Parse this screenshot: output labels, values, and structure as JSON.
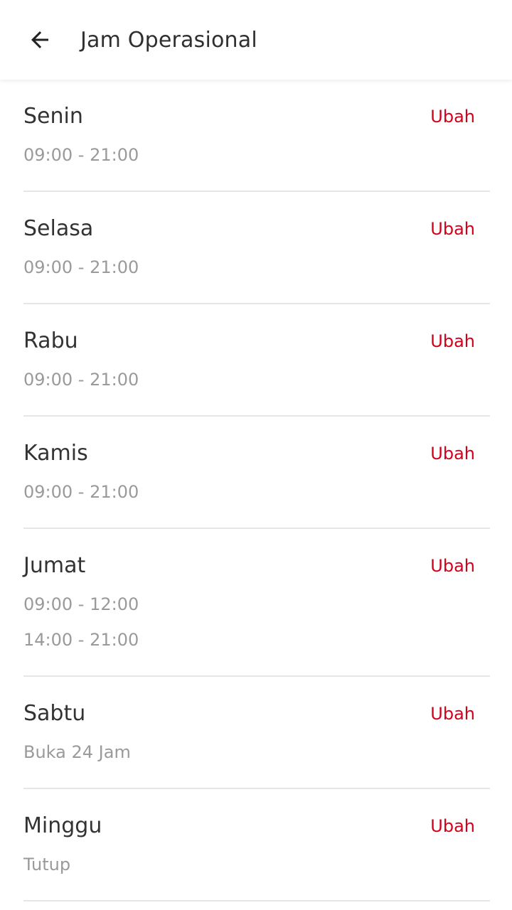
{
  "header": {
    "title": "Jam Operasional",
    "back_icon": "arrow-back-icon"
  },
  "colors": {
    "accent": "#d0021b",
    "day_text": "#333333",
    "hours_text": "#9a9a9a",
    "divider": "#e6e6e6"
  },
  "days": [
    {
      "name": "Senin",
      "edit_label": "Ubah",
      "hours": [
        "09:00 - 21:00"
      ]
    },
    {
      "name": "Selasa",
      "edit_label": "Ubah",
      "hours": [
        "09:00 - 21:00"
      ]
    },
    {
      "name": "Rabu",
      "edit_label": "Ubah",
      "hours": [
        "09:00 - 21:00"
      ]
    },
    {
      "name": "Kamis",
      "edit_label": "Ubah",
      "hours": [
        "09:00 - 21:00"
      ]
    },
    {
      "name": "Jumat",
      "edit_label": "Ubah",
      "hours": [
        "09:00 - 12:00",
        "14:00 - 21:00"
      ]
    },
    {
      "name": "Sabtu",
      "edit_label": "Ubah",
      "hours": [
        "Buka 24 Jam"
      ]
    },
    {
      "name": "Minggu",
      "edit_label": "Ubah",
      "hours": [
        "Tutup"
      ]
    }
  ]
}
